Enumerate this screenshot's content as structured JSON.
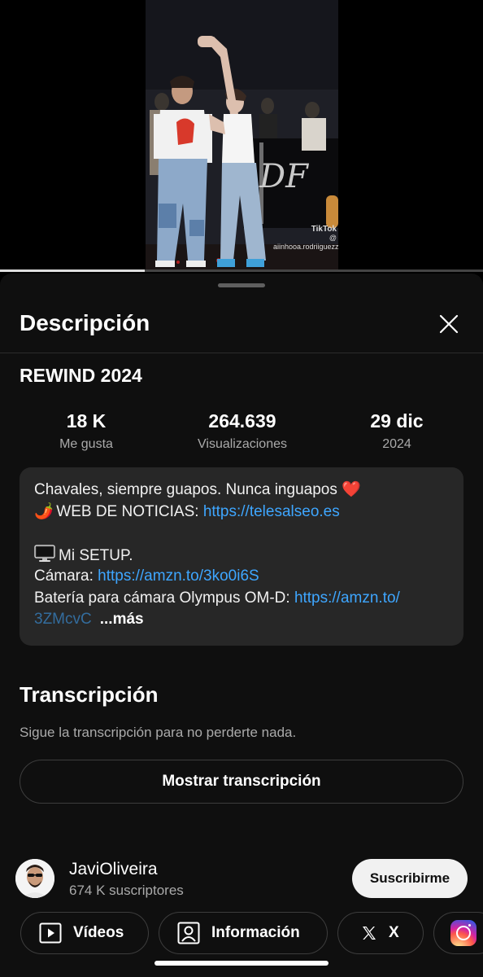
{
  "video": {
    "watermark_brand": "TikTok",
    "watermark_handle": "@ aiinhooa.rodriiguezz",
    "progress_fraction": 0.3
  },
  "sheet": {
    "title": "Descripción",
    "close_icon": "close-icon"
  },
  "details": {
    "video_title": "REWIND 2024",
    "stats": [
      {
        "value": "18 K",
        "label": "Me gusta"
      },
      {
        "value": "264.639",
        "label": "Visualizaciones"
      },
      {
        "value": "29 dic",
        "label": "2024"
      }
    ]
  },
  "description": {
    "line1_text": "Chavales, siempre guapos. Nunca inguapos",
    "line1_emoji": "❤️",
    "line2_emoji": "🌶️",
    "line2_text": "WEB DE NOTICIAS: ",
    "line2_link": "https://telesalseo.es",
    "line3_text": "Mi SETUP.",
    "line4_text": "Cámara: ",
    "line4_link": "https://amzn.to/3ko0i6S",
    "line5_text": "Batería para cámara Olympus OM-D: ",
    "line5_link": "https://amzn.to/",
    "line6_link": "3ZMcvC",
    "more_label": "...más"
  },
  "transcript": {
    "title": "Transcripción",
    "subtitle": "Sigue la transcripción para no perderte nada.",
    "button_label": "Mostrar transcripción"
  },
  "channel": {
    "name": "JaviOliveira",
    "subscribers": "674 K suscriptores",
    "subscribe_label": "Suscribirme"
  },
  "chips": [
    {
      "label": "Vídeos",
      "icon": "play-icon"
    },
    {
      "label": "Información",
      "icon": "person-card-icon"
    },
    {
      "label": "X",
      "icon": "x-logo-icon"
    },
    {
      "label": "",
      "icon": "instagram-icon"
    }
  ],
  "colors": {
    "background": "#0f0f0f",
    "card": "#272727",
    "link": "#3ea6ff",
    "secondary_text": "#aaaaaa"
  }
}
